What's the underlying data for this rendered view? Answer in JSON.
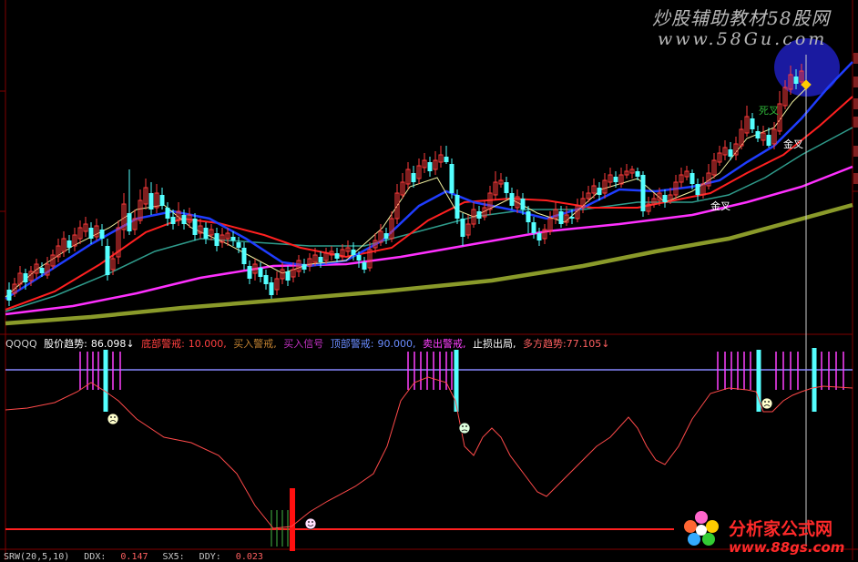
{
  "watermark": {
    "line1": "炒股辅助教材58股网",
    "line2": "www.58Gu.com"
  },
  "indicator_header": {
    "id": "QQQQ",
    "trend_label": "股价趋势:",
    "trend_value": "86.098",
    "trend_arrow": "↓",
    "bottom_warn": "底部警戒:",
    "bottom_warn_value": "10.000,",
    "buy_warn": "买入警戒,",
    "buy_signal": "买入信号",
    "top_warn": "顶部警戒:",
    "top_warn_value": "90.000,",
    "sell_warn": "卖出警戒,",
    "stop_loss": "止损出局,",
    "bull_trend": "多方趋势:",
    "bull_value": "77.105",
    "bull_arrow": "↓"
  },
  "annotations": {
    "golden_cross_1": "金叉",
    "golden_cross_2": "金叉",
    "dead_cross": "死叉"
  },
  "bottom_bar": {
    "a": "SRW(20,5,10)",
    "b": "DDX:",
    "c": "0.147",
    "d": "SX5:",
    "e": "DDY:",
    "f": "0.023"
  },
  "logo": {
    "name": "分析家公式网",
    "url": "www.88gs.com"
  },
  "colors": {
    "background": "#000000",
    "up_candle": "#ff3b3b",
    "down_candle": "#54ffff",
    "ma_white": "#f0f0a0",
    "ma_blue": "#1f3dff",
    "ma_red": "#ff2020",
    "ma_teal": "#2f9c8c",
    "ma_magenta": "#ff30ff",
    "ma_olive": "#8a9a2a",
    "trend_line": "#ff4a4a",
    "top_line": "#8888ff",
    "bottom_line": "#ff2020"
  }
}
